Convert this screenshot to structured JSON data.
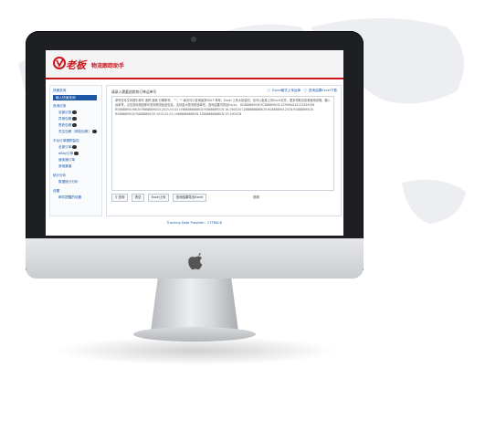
{
  "header": {
    "brand": "老板",
    "tagline": "物流跟踪助手"
  },
  "sidebar": {
    "groups": [
      {
        "label": "快速查询"
      },
      {
        "label": "查询记录"
      },
      {
        "label": "平台订单跟踪监控"
      },
      {
        "label": "统计分析"
      },
      {
        "label": "设置"
      }
    ],
    "active_item": "输入快速查询",
    "items": [
      {
        "label": "全部记录"
      },
      {
        "label": "异常包裹"
      },
      {
        "label": "签收包裹"
      },
      {
        "label": "关注包裹（风险包裹）"
      },
      {
        "label": "全部订单"
      },
      {
        "label": "eBay订单"
      },
      {
        "label": "速卖通订单"
      },
      {
        "label": "其他渠道"
      },
      {
        "label": "数据统计分析"
      },
      {
        "label": "邮件提醒的设置"
      }
    ]
  },
  "main": {
    "title": "请录入需要追踪的订单运单号",
    "link_excel": "Excel格式上传运单",
    "link_download": "查询结果Excel下载",
    "textarea_text": "单号在本文本框中填写 追踪 速卖 分隔单号。 \"\"，\"\" 每天可以查询最多500个单号，Excel 上传大批量的，也可以批量上传Excel文件，更多帮助请查看使用说明。输入运单号，点击查询按钮即可查询物流轨迹信息，支持各大物流快递单号，查询结果可导出Excel。 RG888890CN RC888890CN 1Z999AA10123456784 RG888890198CN RR888890CN 2015-03-02 LY888888888CN RG888890CN 16.1900CN 1Z888888888CN RG888890123CN RG888890CN RG888890CN RG888890CN 2015-02-02 LX888888888CN 1Z888888888CN 15.1900CN",
    "btn_query": "查询",
    "btn_clear": "清空",
    "btn_excel_upload": "Excel上传",
    "btn_result_excel": "查询结果导出Excel",
    "help_text": "说明",
    "footer": "Tracking Data Provider：17TRACK"
  },
  "colors": {
    "brand_red": "#c8161d",
    "link_blue": "#1b57a5"
  }
}
